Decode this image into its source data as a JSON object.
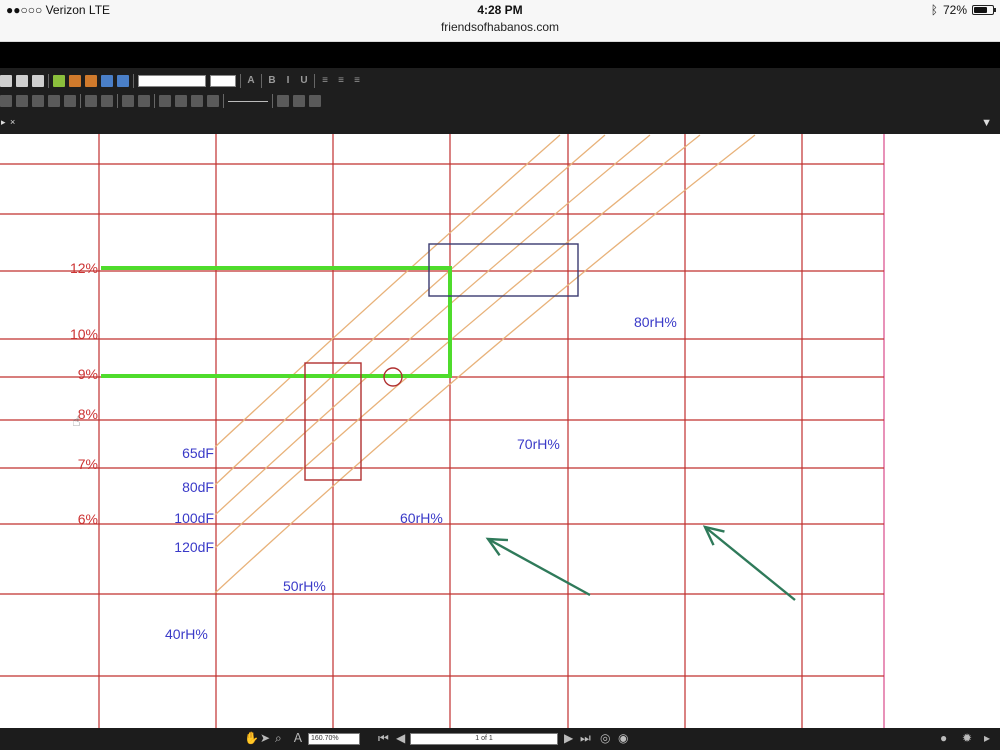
{
  "status_bar": {
    "carrier": "●●○○○ Verizon  LTE",
    "time": "4:28 PM",
    "url": "friendsofhabanos.com",
    "bluetooth_icon": "bluetooth-icon",
    "battery_text": "72%",
    "battery_level": 0.72
  },
  "viewer": {
    "zoom": "160.70%",
    "page": "1 of 1"
  },
  "chart_data": {
    "type": "line",
    "title": "",
    "y_ticks": [
      "12%",
      "10%",
      "9%",
      "8%",
      "7%",
      "6%"
    ],
    "temperature_labels": [
      "65dF",
      "80dF",
      "100dF",
      "120dF"
    ],
    "humidity_labels": [
      "40rH%",
      "50rH%",
      "60rH%",
      "70rH%",
      "80rH%"
    ],
    "series": [
      {
        "values": [
          [
            215,
            447
          ],
          [
            560,
            135
          ]
        ]
      },
      {
        "values": [
          [
            215,
            485
          ],
          [
            605,
            135
          ]
        ]
      },
      {
        "values": [
          [
            215,
            515
          ],
          [
            650,
            135
          ]
        ]
      },
      {
        "values": [
          [
            215,
            548
          ],
          [
            700,
            135
          ]
        ]
      },
      {
        "values": [
          [
            215,
            593
          ],
          [
            755,
            135
          ]
        ]
      }
    ],
    "highlight_path": {
      "from": "12%",
      "to": "9%",
      "color": "#4fdc2c"
    },
    "colors": {
      "grid": "#c0302f",
      "curves": "#e8b27a",
      "labels": "#3a3ac8",
      "ticks": "#cc3333",
      "arrows": "#2f7a5a",
      "boxes": "#3a3a70",
      "box_red": "#b03030"
    }
  }
}
